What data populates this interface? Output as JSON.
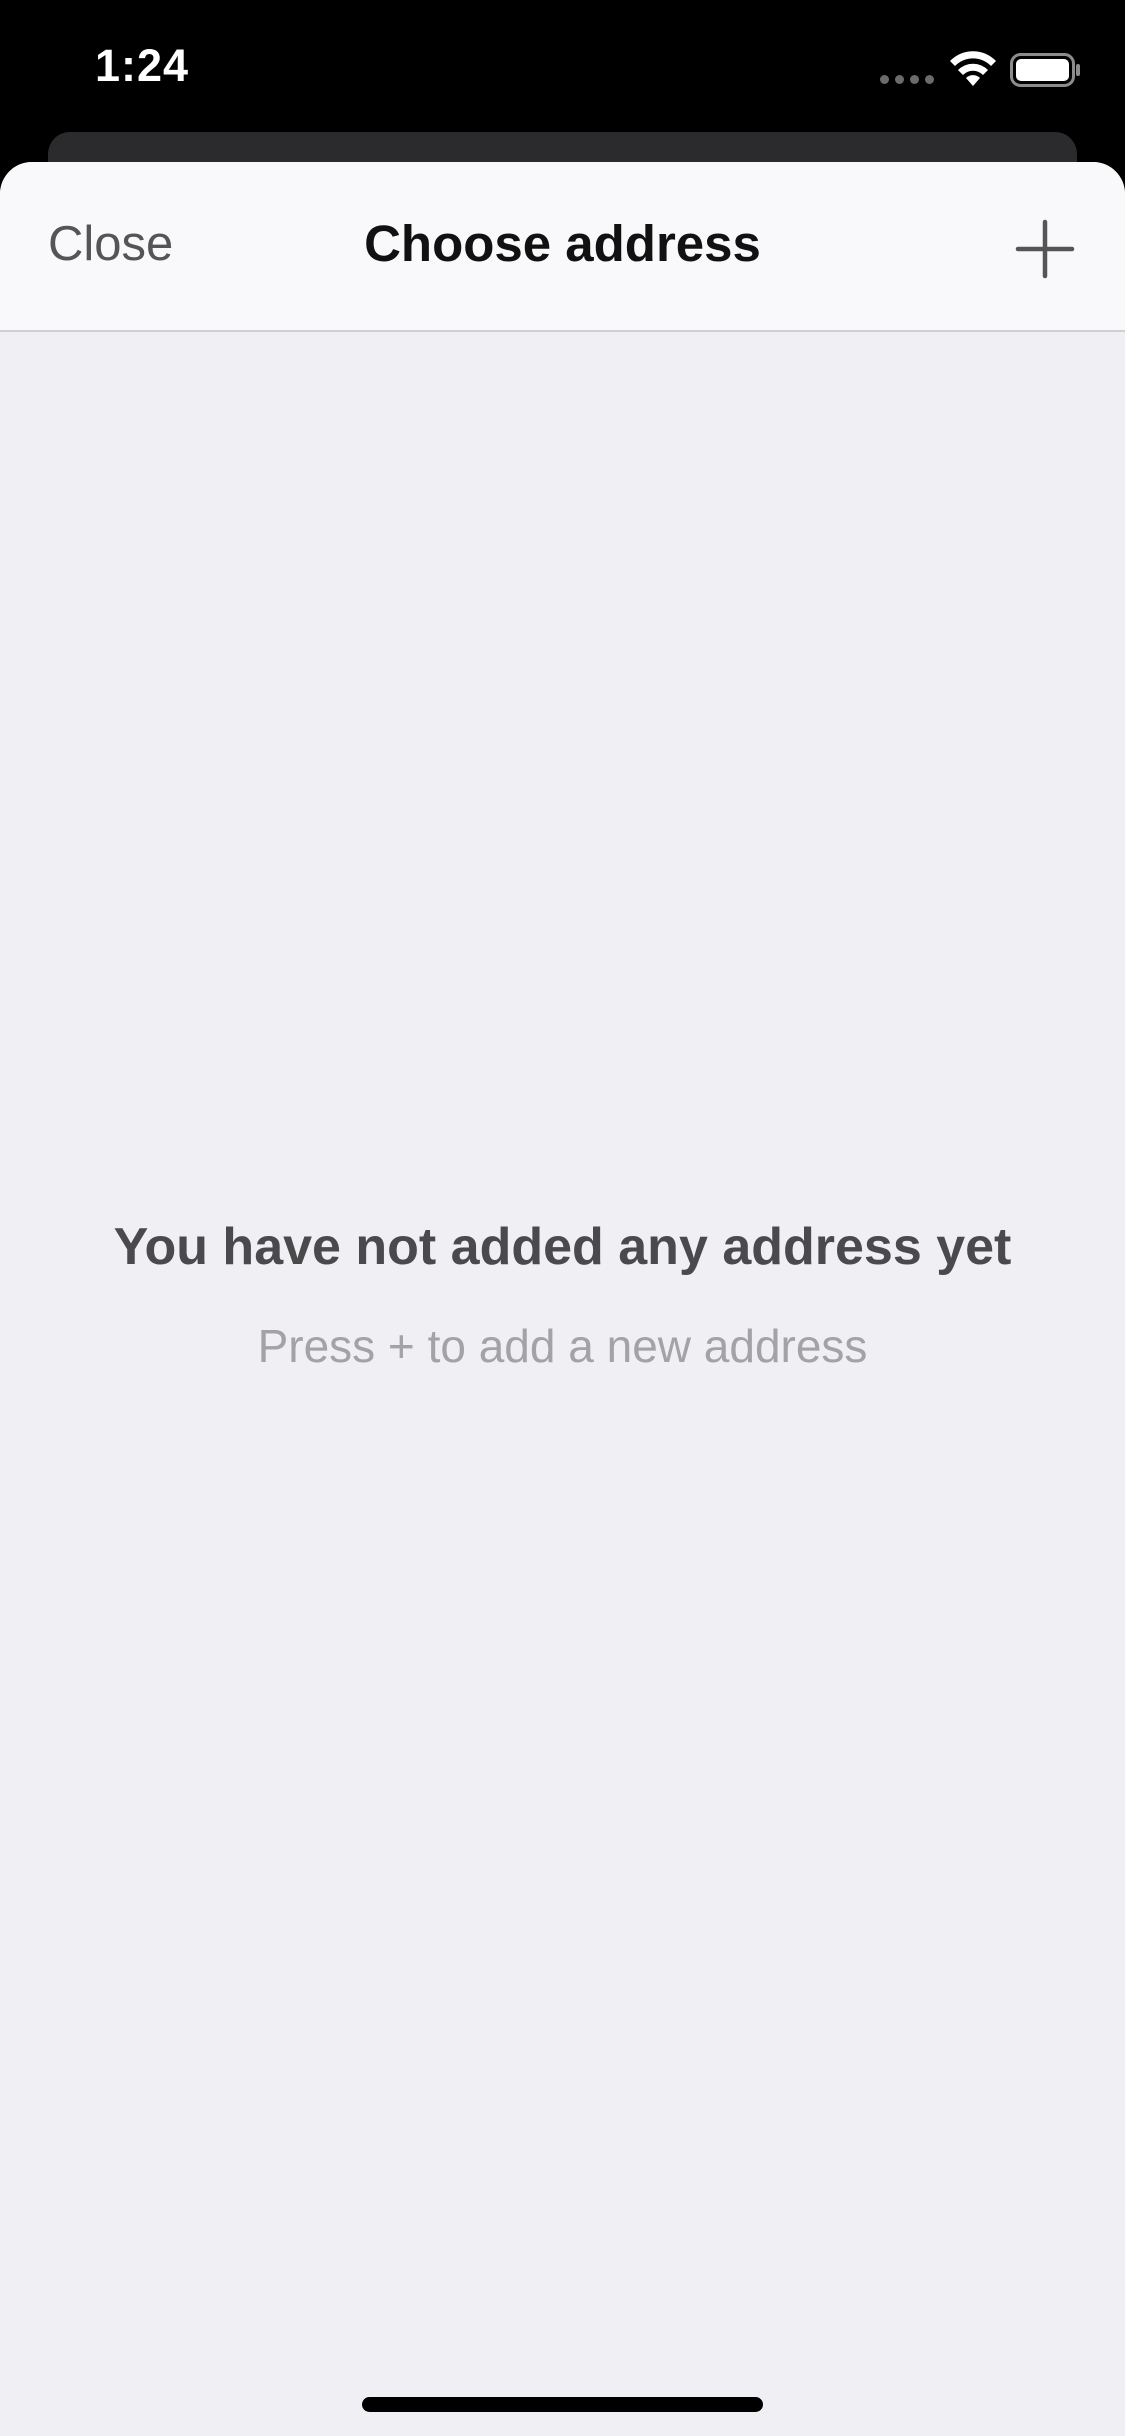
{
  "status_bar": {
    "time": "1:24",
    "icons": [
      "signal-dots-icon",
      "wifi-icon",
      "battery-icon"
    ]
  },
  "nav": {
    "close_label": "Close",
    "title": "Choose address",
    "add_icon": "plus-icon"
  },
  "empty_state": {
    "title": "You have not added any address yet",
    "subtitle": "Press + to add a new address"
  },
  "colors": {
    "sheet_background": "#f0eff4",
    "nav_background": "#f9f9fb",
    "title_text": "#111111",
    "secondary_text": "#a3a3a7"
  }
}
